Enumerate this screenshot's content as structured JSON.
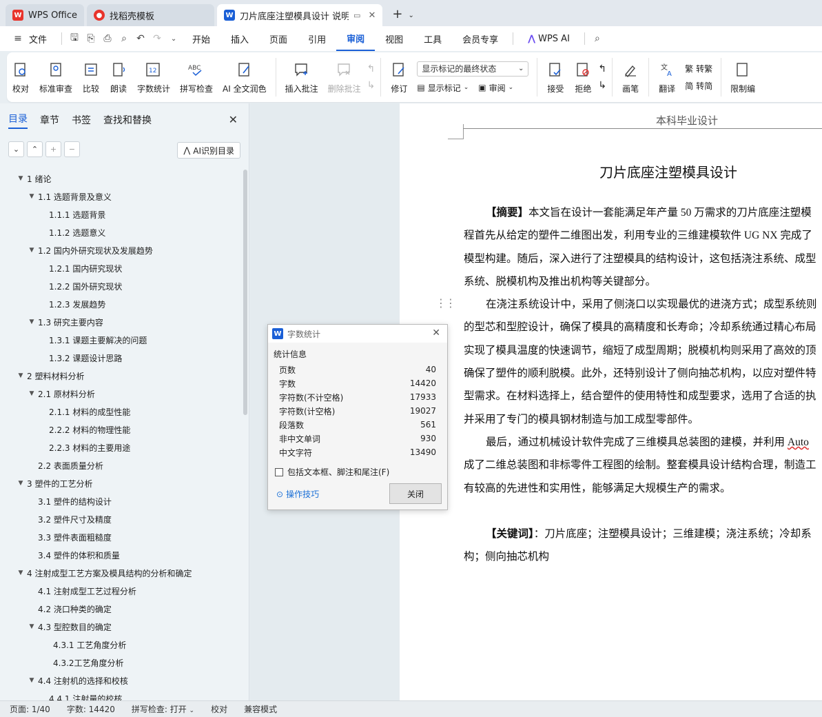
{
  "tabs": [
    {
      "label": "WPS Office",
      "icon": "wps-logo-icon",
      "color": "#e8342c"
    },
    {
      "label": "找稻壳模板",
      "icon": "docer-logo-icon",
      "color": "#e8342c"
    },
    {
      "label": "刀片底座注塑模具设计 说明书",
      "icon": "word-doc-icon",
      "color": "#1a5fd6"
    }
  ],
  "menu": {
    "file": "文件",
    "items": [
      "开始",
      "插入",
      "页面",
      "引用",
      "审阅",
      "视图",
      "工具",
      "会员专享"
    ],
    "active": "审阅",
    "wps_ai": "WPS AI"
  },
  "ribbon": {
    "proofread": "校对",
    "standard_review": "标准审查",
    "compare": "比较",
    "read_aloud": "朗读",
    "word_count": "字数统计",
    "spell_check": "拼写检查",
    "ai_polish": "AI 全文润色",
    "insert_comment": "插入批注",
    "delete_comment": "删除批注",
    "track_changes": "修订",
    "markup_dropdown": "显示标记的最终状态",
    "show_markup": "显示标记",
    "review": "审阅",
    "accept": "接受",
    "reject": "拒绝",
    "pen": "画笔",
    "translate": "翻译",
    "to_traditional": "转繁",
    "to_simplified": "转简",
    "restrict_edit": "限制编"
  },
  "nav": {
    "tabs": [
      "目录",
      "章节",
      "书签",
      "查找和替换"
    ],
    "ai_toc": "AI识别目录",
    "toc": [
      {
        "level": 0,
        "text": "1  绪论",
        "arrow": true
      },
      {
        "level": 1,
        "text": "1.1  选题背景及意义",
        "arrow": true
      },
      {
        "level": 2,
        "text": "1.1.1  选题背景",
        "arrow": false
      },
      {
        "level": 2,
        "text": "1.1.2  选题意义",
        "arrow": false
      },
      {
        "level": 1,
        "text": "1.2  国内外研究现状及发展趋势",
        "arrow": true
      },
      {
        "level": 2,
        "text": "1.2.1  国内研究现状",
        "arrow": false
      },
      {
        "level": 2,
        "text": "1.2.2  国外研究现状",
        "arrow": false
      },
      {
        "level": 2,
        "text": "1.2.3  发展趋势",
        "arrow": false
      },
      {
        "level": 1,
        "text": "1.3  研究主要内容",
        "arrow": true
      },
      {
        "level": 2,
        "text": "1.3.1  课题主要解决的问题",
        "arrow": false
      },
      {
        "level": 2,
        "text": "1.3.2  课题设计思路",
        "arrow": false
      },
      {
        "level": 0,
        "text": "2  塑料材料分析",
        "arrow": true
      },
      {
        "level": 1,
        "text": "2.1  原材料分析",
        "arrow": true
      },
      {
        "level": 2,
        "text": "2.1.1 材料的成型性能",
        "arrow": false
      },
      {
        "level": 2,
        "text": "2.2.2  材料的物理性能",
        "arrow": false
      },
      {
        "level": 2,
        "text": "2.2.3  材料的主要用途",
        "arrow": false
      },
      {
        "level": 1,
        "text": "2.2 表面质量分析",
        "arrow": false
      },
      {
        "level": 0,
        "text": "3  塑件的工艺分析",
        "arrow": true
      },
      {
        "level": 1,
        "text": "3.1  塑件的结构设计",
        "arrow": false
      },
      {
        "level": 1,
        "text": "3.2  塑件尺寸及精度",
        "arrow": false
      },
      {
        "level": 1,
        "text": "3.3  塑件表面粗糙度",
        "arrow": false
      },
      {
        "level": 1,
        "text": "3.4  塑件的体积和质量",
        "arrow": false
      },
      {
        "level": 0,
        "text": "4  注射成型工艺方案及模具结构的分析和确定",
        "arrow": true
      },
      {
        "level": 1,
        "text": "4.1  注射成型工艺过程分析",
        "arrow": false
      },
      {
        "level": 1,
        "text": "4.2 浇口种类的确定",
        "arrow": false
      },
      {
        "level": 1,
        "text": "4.3  型腔数目的确定",
        "arrow": true
      },
      {
        "level": 3,
        "text": "4.3.1 工艺角度分析",
        "arrow": false
      },
      {
        "level": 3,
        "text": "4.3.2工艺角度分析",
        "arrow": false
      },
      {
        "level": 1,
        "text": "4.4  注射机的选择和校核",
        "arrow": true
      },
      {
        "level": 2,
        "text": "4.4.1  注射量的校核",
        "arrow": false
      }
    ]
  },
  "document": {
    "header": "本科毕业设计",
    "title": "刀片底座注塑模具设计",
    "lines": [
      {
        "indent": true,
        "bold_prefix": "【摘要】",
        "text": "本文旨在设计一套能满足年产量 50 万需求的刀片底座注塑模"
      },
      {
        "indent": false,
        "text": "程首先从给定的塑件二维图出发，利用专业的三维建模软件 UG NX 完成了"
      },
      {
        "indent": false,
        "text": "模型构建。随后，深入进行了注塑模具的结构设计，这包括浇注系统、成型"
      },
      {
        "indent": false,
        "text": "系统、脱模机构及推出机构等关键部分。"
      },
      {
        "indent": true,
        "text": "在浇注系统设计中，采用了侧浇口以实现最优的进浇方式；成型系统则"
      },
      {
        "indent": false,
        "text": "的型芯和型腔设计，确保了模具的高精度和长寿命；冷却系统通过精心布局"
      },
      {
        "indent": false,
        "text": "实现了模具温度的快速调节，缩短了成型周期；脱模机构则采用了高效的顶"
      },
      {
        "indent": false,
        "text": "确保了塑件的顺利脱模。此外，还特别设计了侧向抽芯机构，以应对塑件特"
      },
      {
        "indent": false,
        "text": "型需求。在材料选择上，结合塑件的使用特性和成型要求，选用了合适的执"
      },
      {
        "indent": false,
        "text": "并采用了专门的模具钢材制造与加工成型零部件。"
      },
      {
        "indent": true,
        "text": "最后，通过机械设计软件完成了三维模具总装图的建模，并利用 ",
        "wavy": "Auto"
      },
      {
        "indent": false,
        "text": "成了二维总装图和非标零件工程图的绘制。整套模具设计结构合理，制造工"
      },
      {
        "indent": false,
        "text": "有较高的先进性和实用性，能够满足大规模生产的需求。"
      },
      {
        "indent": false,
        "text": ""
      },
      {
        "indent": true,
        "bold_prefix": "【关键词】",
        "text": "：刀片底座；注塑模具设计；三维建模；浇注系统；冷却系"
      },
      {
        "indent": false,
        "text": "构；侧向抽芯机构"
      }
    ]
  },
  "dialog": {
    "title": "字数统计",
    "section": "统计信息",
    "stats": [
      {
        "label": "页数",
        "value": "40"
      },
      {
        "label": "字数",
        "value": "14420"
      },
      {
        "label": "字符数(不计空格)",
        "value": "17933"
      },
      {
        "label": "字符数(计空格)",
        "value": "19027"
      },
      {
        "label": "段落数",
        "value": "561"
      },
      {
        "label": "非中文单词",
        "value": "930"
      },
      {
        "label": "中文字符",
        "value": "13490"
      }
    ],
    "checkbox": "包括文本框、脚注和尾注(F)",
    "tips": "操作技巧",
    "close": "关闭"
  },
  "status": {
    "page": "页面: 1/40",
    "words": "字数: 14420",
    "spell": "拼写检查: 打开",
    "proof": "校对",
    "compat": "兼容模式"
  }
}
